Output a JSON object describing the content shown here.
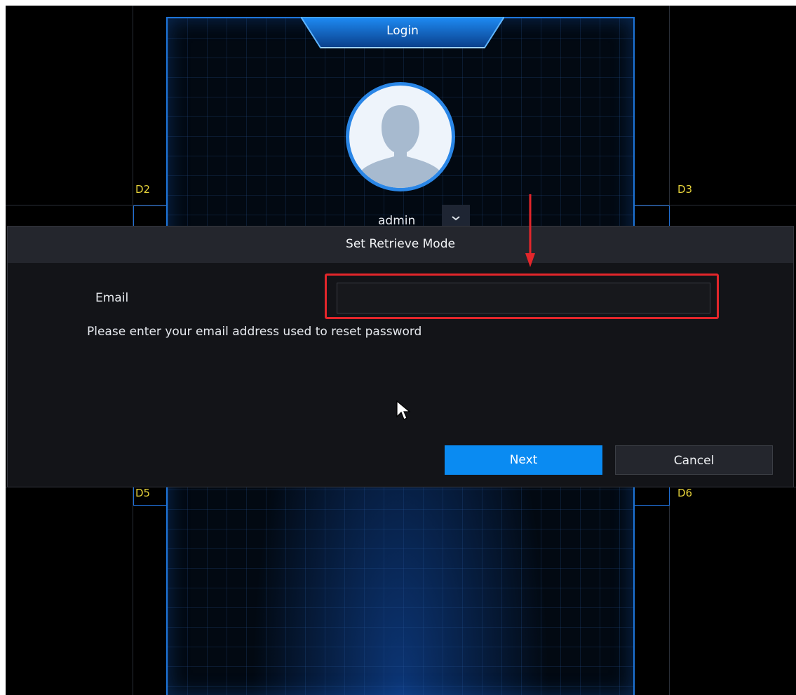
{
  "login": {
    "title": "Login",
    "username": "admin"
  },
  "channels": {
    "d2": "D2",
    "d3": "D3",
    "d5": "D5",
    "d6": "D6"
  },
  "dialog": {
    "title": "Set Retrieve Mode",
    "email_label": "Email",
    "email_value": "",
    "hint": "Please enter your email address used to reset password",
    "next_label": "Next",
    "cancel_label": "Cancel"
  },
  "icons": {
    "avatar": "user-silhouette-icon",
    "dropdown": "chevron-down-icon",
    "cursor": "mouse-pointer-icon",
    "annotation": "red-arrow-icon"
  },
  "colors": {
    "accent": "#0a8bf2",
    "panel_border": "#1d74d8",
    "channel_label": "#e6d23a",
    "highlight": "#e3262b"
  }
}
